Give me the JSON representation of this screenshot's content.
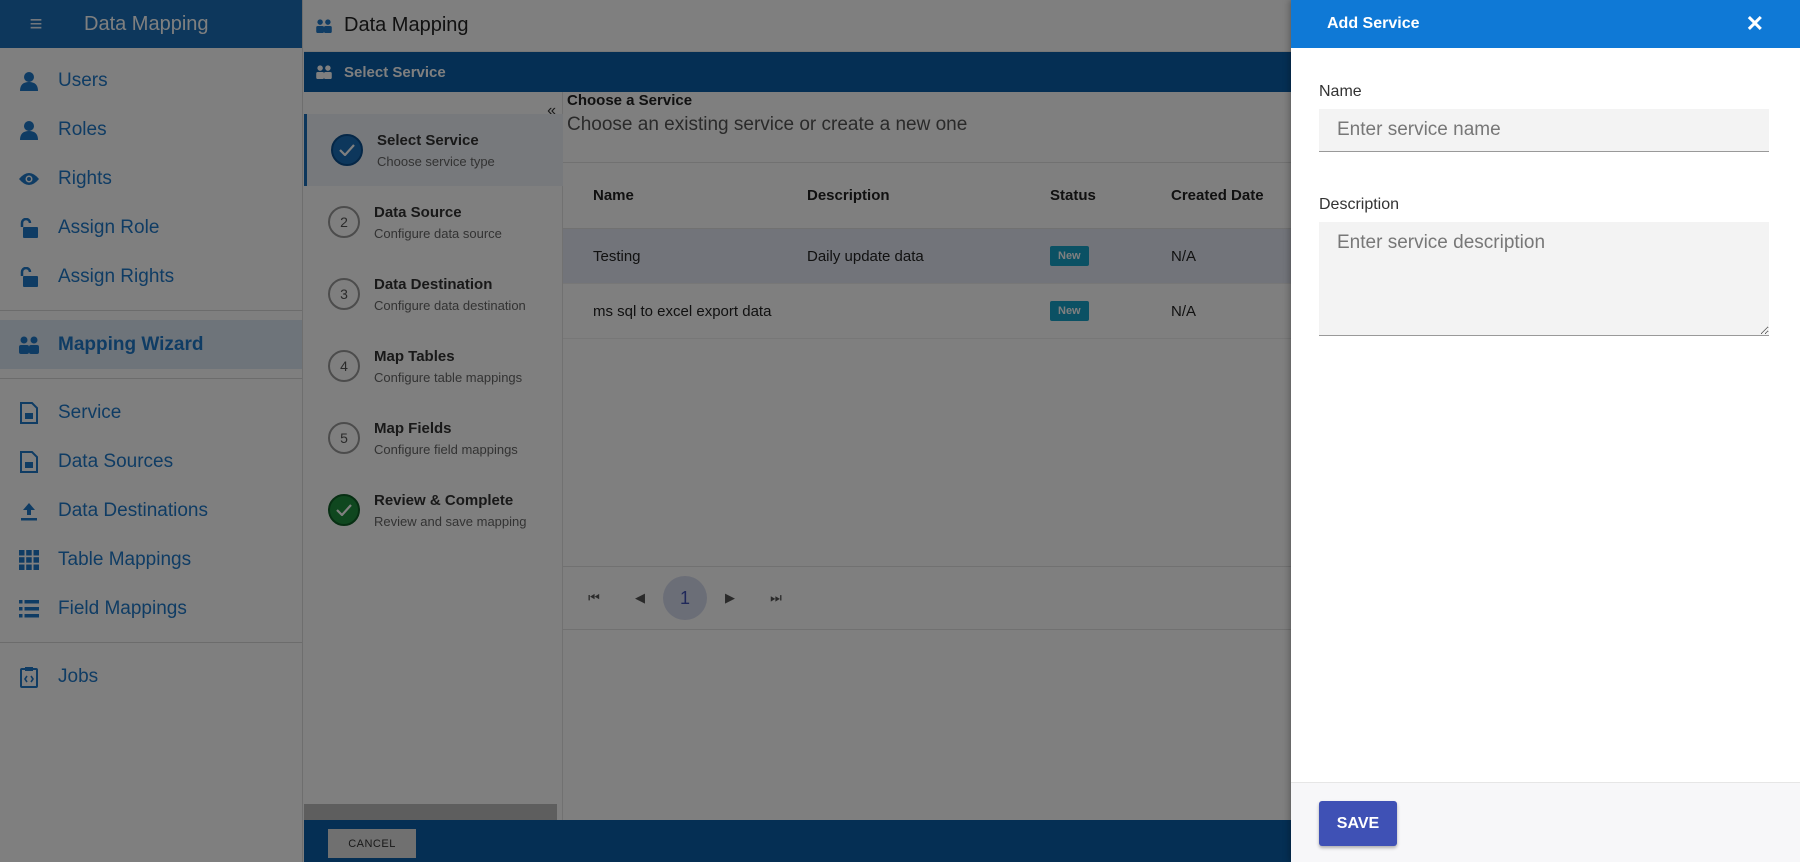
{
  "app": {
    "title": "Data Mapping"
  },
  "sidebar": {
    "items": [
      {
        "label": "Users",
        "icon": "user-icon"
      },
      {
        "label": "Roles",
        "icon": "user-icon"
      },
      {
        "label": "Rights",
        "icon": "eye-icon"
      },
      {
        "label": "Assign Role",
        "icon": "unlock-icon"
      },
      {
        "label": "Assign Rights",
        "icon": "unlock-icon"
      },
      {
        "label": "Mapping Wizard",
        "icon": "people-icon",
        "active": true
      },
      {
        "label": "Service",
        "icon": "document-icon"
      },
      {
        "label": "Data Sources",
        "icon": "document-icon"
      },
      {
        "label": "Data Destinations",
        "icon": "upload-icon"
      },
      {
        "label": "Table Mappings",
        "icon": "grid-icon"
      },
      {
        "label": "Field Mappings",
        "icon": "list-icon"
      },
      {
        "label": "Jobs",
        "icon": "clipboard-code-icon"
      }
    ]
  },
  "main": {
    "title": "Data Mapping",
    "wizard_title": "Select Service",
    "steps": [
      {
        "number": "",
        "title": "Select Service",
        "subtitle": "Choose service type",
        "state": "done"
      },
      {
        "number": "2",
        "title": "Data Source",
        "subtitle": "Configure data source"
      },
      {
        "number": "3",
        "title": "Data Destination",
        "subtitle": "Configure data destination"
      },
      {
        "number": "4",
        "title": "Map Tables",
        "subtitle": "Configure table mappings"
      },
      {
        "number": "5",
        "title": "Map Fields",
        "subtitle": "Configure field mappings"
      },
      {
        "number": "",
        "title": "Review & Complete",
        "subtitle": "Review and save mapping",
        "state": "done"
      }
    ],
    "content_title": "Choose a Service",
    "content_subtitle": "Choose an existing service or create a new one",
    "table": {
      "headers": [
        "Name",
        "Description",
        "Status",
        "Created Date"
      ],
      "rows": [
        {
          "name": "Testing",
          "description": "Daily update data",
          "status": "New",
          "created": "N/A"
        },
        {
          "name": "ms sql to excel export data",
          "description": "",
          "status": "New",
          "created": "N/A"
        }
      ]
    },
    "pager": {
      "current_page": "1"
    },
    "cancel_label": "CANCEL"
  },
  "drawer": {
    "title": "Add Service",
    "name_label": "Name",
    "name_placeholder": "Enter service name",
    "name_value": "",
    "description_label": "Description",
    "description_placeholder": "Enter service description",
    "description_value": "",
    "save_label": "SAVE"
  },
  "colors": {
    "primary": "#0f79d6",
    "wizard_bar": "#0b5fa8",
    "save": "#3f51b5",
    "badge": "#17a2c8",
    "success": "#1e8e3e"
  }
}
